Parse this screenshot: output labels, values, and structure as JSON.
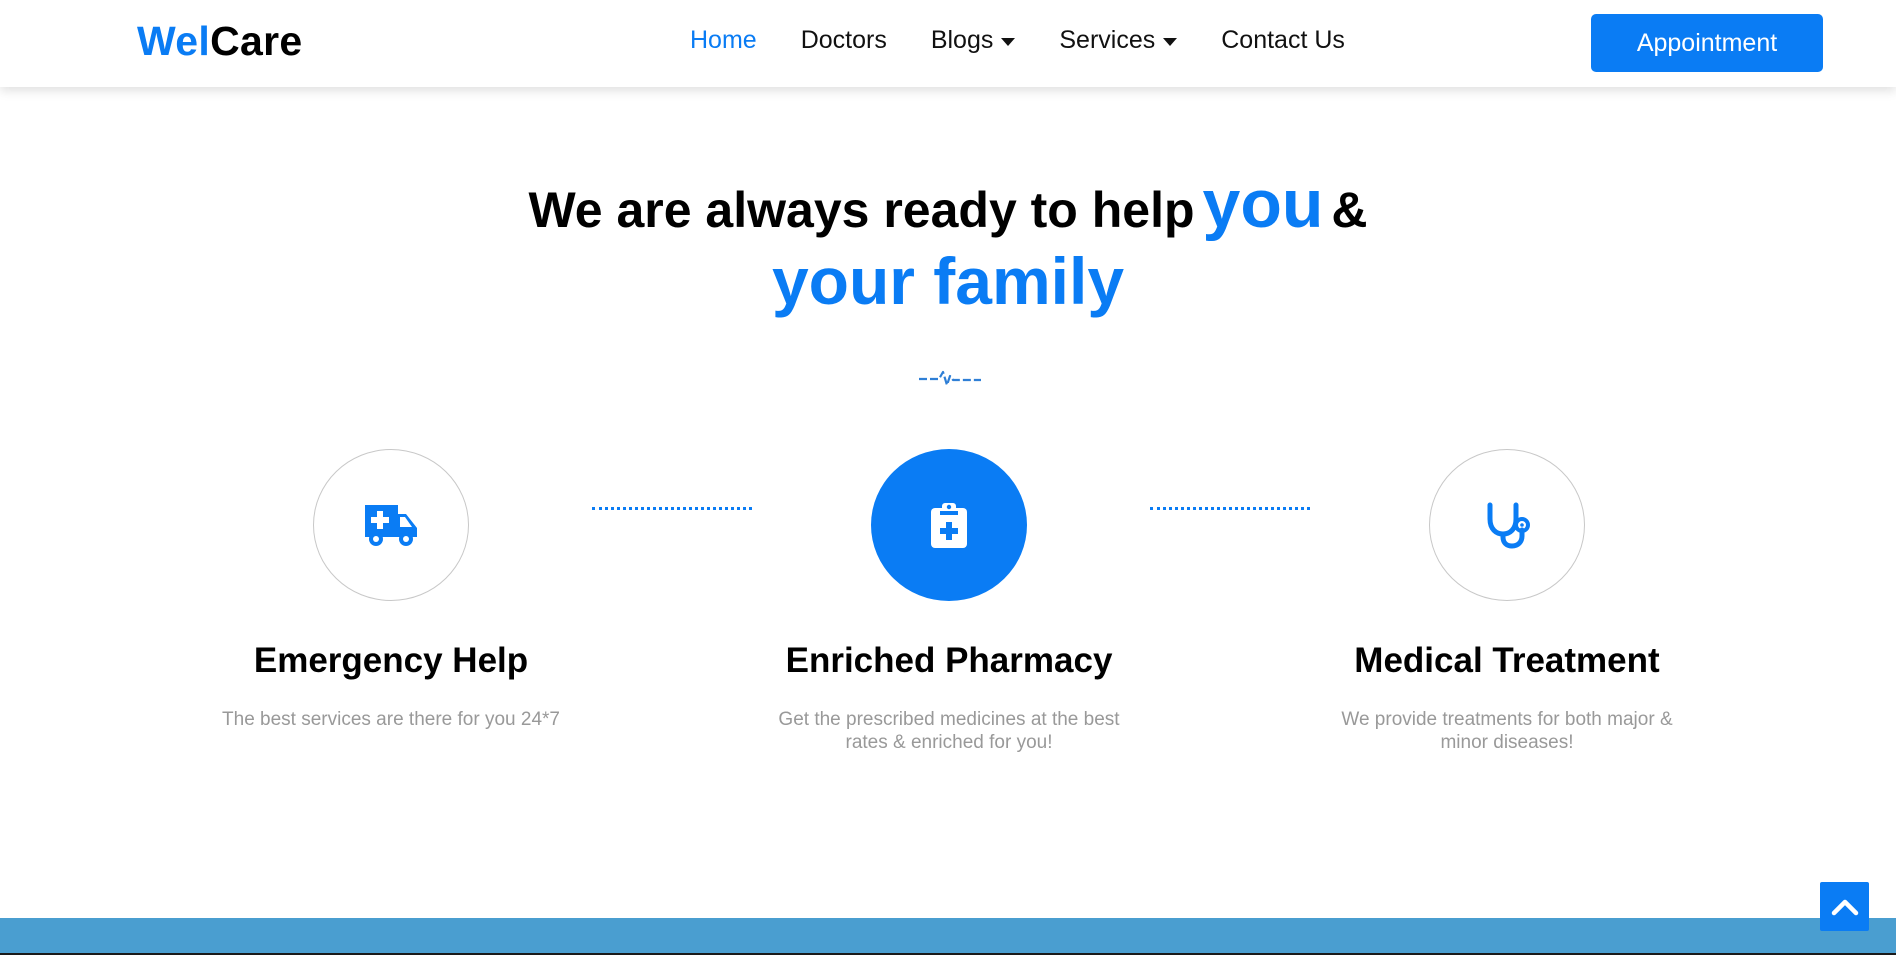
{
  "brand": {
    "part1": "Wel",
    "part2": "Care"
  },
  "nav": {
    "items": [
      {
        "label": "Home",
        "active": true,
        "dropdown": false
      },
      {
        "label": "Doctors",
        "active": false,
        "dropdown": false
      },
      {
        "label": "Blogs",
        "active": false,
        "dropdown": true
      },
      {
        "label": "Services",
        "active": false,
        "dropdown": true
      },
      {
        "label": "Contact Us",
        "active": false,
        "dropdown": false
      }
    ],
    "appointment_label": "Appointment"
  },
  "hero": {
    "line1_start": "We are always ready to help",
    "line1_emphasis": "you",
    "line1_end": "&",
    "line2": "your family",
    "divider_icon": "heartbeat-pulse-icon"
  },
  "features": [
    {
      "icon": "ambulance-icon",
      "title": "Emergency Help",
      "description": "The best services are there for you 24*7",
      "highlighted": false
    },
    {
      "icon": "clipboard-medical-icon",
      "title": "Enriched Pharmacy",
      "description": "Get the prescribed medicines at the best rates & enriched for you!",
      "highlighted": true
    },
    {
      "icon": "stethoscope-icon",
      "title": "Medical Treatment",
      "description": "We provide treatments for both major & minor diseases!",
      "highlighted": false
    }
  ],
  "scroll_top_icon": "chevron-up-icon",
  "colors": {
    "accent": "#0a7cf4",
    "muted_text": "#999999",
    "footer_strip": "#4a9ed0"
  }
}
